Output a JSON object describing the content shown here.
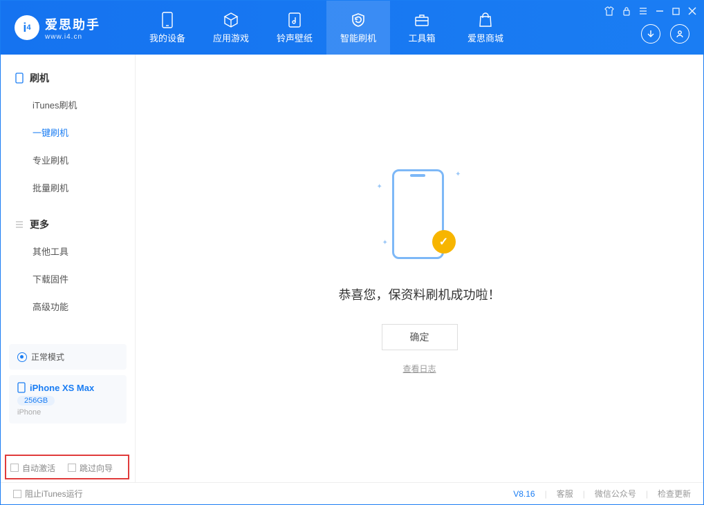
{
  "app": {
    "title": "爱思助手",
    "subtitle": "www.i4.cn"
  },
  "topnav": [
    {
      "label": "我的设备"
    },
    {
      "label": "应用游戏"
    },
    {
      "label": "铃声壁纸"
    },
    {
      "label": "智能刷机"
    },
    {
      "label": "工具箱"
    },
    {
      "label": "爱思商城"
    }
  ],
  "active_topnav": 3,
  "sidebar": {
    "section1": {
      "title": "刷机",
      "items": [
        "iTunes刷机",
        "一键刷机",
        "专业刷机",
        "批量刷机"
      ],
      "active": 1
    },
    "section2": {
      "title": "更多",
      "items": [
        "其他工具",
        "下载固件",
        "高级功能"
      ]
    }
  },
  "mode": {
    "label": "正常模式"
  },
  "device": {
    "name": "iPhone XS Max",
    "capacity": "256GB",
    "type": "iPhone"
  },
  "checks": {
    "auto_activate": "自动激活",
    "skip_guide": "跳过向导"
  },
  "main": {
    "message": "恭喜您，保资料刷机成功啦！",
    "ok": "确定",
    "log_link": "查看日志"
  },
  "status": {
    "block_itunes": "阻止iTunes运行",
    "version": "V8.16",
    "links": [
      "客服",
      "微信公众号",
      "检查更新"
    ]
  }
}
